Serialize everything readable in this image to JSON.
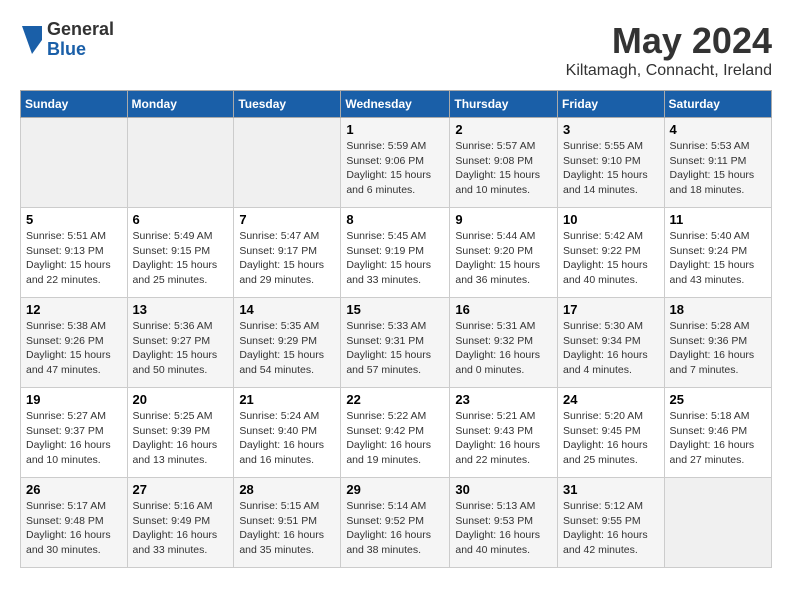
{
  "header": {
    "logo_general": "General",
    "logo_blue": "Blue",
    "month": "May 2024",
    "location": "Kiltamagh, Connacht, Ireland"
  },
  "weekdays": [
    "Sunday",
    "Monday",
    "Tuesday",
    "Wednesday",
    "Thursday",
    "Friday",
    "Saturday"
  ],
  "weeks": [
    [
      {
        "day": "",
        "info": ""
      },
      {
        "day": "",
        "info": ""
      },
      {
        "day": "",
        "info": ""
      },
      {
        "day": "1",
        "info": "Sunrise: 5:59 AM\nSunset: 9:06 PM\nDaylight: 15 hours\nand 6 minutes."
      },
      {
        "day": "2",
        "info": "Sunrise: 5:57 AM\nSunset: 9:08 PM\nDaylight: 15 hours\nand 10 minutes."
      },
      {
        "day": "3",
        "info": "Sunrise: 5:55 AM\nSunset: 9:10 PM\nDaylight: 15 hours\nand 14 minutes."
      },
      {
        "day": "4",
        "info": "Sunrise: 5:53 AM\nSunset: 9:11 PM\nDaylight: 15 hours\nand 18 minutes."
      }
    ],
    [
      {
        "day": "5",
        "info": "Sunrise: 5:51 AM\nSunset: 9:13 PM\nDaylight: 15 hours\nand 22 minutes."
      },
      {
        "day": "6",
        "info": "Sunrise: 5:49 AM\nSunset: 9:15 PM\nDaylight: 15 hours\nand 25 minutes."
      },
      {
        "day": "7",
        "info": "Sunrise: 5:47 AM\nSunset: 9:17 PM\nDaylight: 15 hours\nand 29 minutes."
      },
      {
        "day": "8",
        "info": "Sunrise: 5:45 AM\nSunset: 9:19 PM\nDaylight: 15 hours\nand 33 minutes."
      },
      {
        "day": "9",
        "info": "Sunrise: 5:44 AM\nSunset: 9:20 PM\nDaylight: 15 hours\nand 36 minutes."
      },
      {
        "day": "10",
        "info": "Sunrise: 5:42 AM\nSunset: 9:22 PM\nDaylight: 15 hours\nand 40 minutes."
      },
      {
        "day": "11",
        "info": "Sunrise: 5:40 AM\nSunset: 9:24 PM\nDaylight: 15 hours\nand 43 minutes."
      }
    ],
    [
      {
        "day": "12",
        "info": "Sunrise: 5:38 AM\nSunset: 9:26 PM\nDaylight: 15 hours\nand 47 minutes."
      },
      {
        "day": "13",
        "info": "Sunrise: 5:36 AM\nSunset: 9:27 PM\nDaylight: 15 hours\nand 50 minutes."
      },
      {
        "day": "14",
        "info": "Sunrise: 5:35 AM\nSunset: 9:29 PM\nDaylight: 15 hours\nand 54 minutes."
      },
      {
        "day": "15",
        "info": "Sunrise: 5:33 AM\nSunset: 9:31 PM\nDaylight: 15 hours\nand 57 minutes."
      },
      {
        "day": "16",
        "info": "Sunrise: 5:31 AM\nSunset: 9:32 PM\nDaylight: 16 hours\nand 0 minutes."
      },
      {
        "day": "17",
        "info": "Sunrise: 5:30 AM\nSunset: 9:34 PM\nDaylight: 16 hours\nand 4 minutes."
      },
      {
        "day": "18",
        "info": "Sunrise: 5:28 AM\nSunset: 9:36 PM\nDaylight: 16 hours\nand 7 minutes."
      }
    ],
    [
      {
        "day": "19",
        "info": "Sunrise: 5:27 AM\nSunset: 9:37 PM\nDaylight: 16 hours\nand 10 minutes."
      },
      {
        "day": "20",
        "info": "Sunrise: 5:25 AM\nSunset: 9:39 PM\nDaylight: 16 hours\nand 13 minutes."
      },
      {
        "day": "21",
        "info": "Sunrise: 5:24 AM\nSunset: 9:40 PM\nDaylight: 16 hours\nand 16 minutes."
      },
      {
        "day": "22",
        "info": "Sunrise: 5:22 AM\nSunset: 9:42 PM\nDaylight: 16 hours\nand 19 minutes."
      },
      {
        "day": "23",
        "info": "Sunrise: 5:21 AM\nSunset: 9:43 PM\nDaylight: 16 hours\nand 22 minutes."
      },
      {
        "day": "24",
        "info": "Sunrise: 5:20 AM\nSunset: 9:45 PM\nDaylight: 16 hours\nand 25 minutes."
      },
      {
        "day": "25",
        "info": "Sunrise: 5:18 AM\nSunset: 9:46 PM\nDaylight: 16 hours\nand 27 minutes."
      }
    ],
    [
      {
        "day": "26",
        "info": "Sunrise: 5:17 AM\nSunset: 9:48 PM\nDaylight: 16 hours\nand 30 minutes."
      },
      {
        "day": "27",
        "info": "Sunrise: 5:16 AM\nSunset: 9:49 PM\nDaylight: 16 hours\nand 33 minutes."
      },
      {
        "day": "28",
        "info": "Sunrise: 5:15 AM\nSunset: 9:51 PM\nDaylight: 16 hours\nand 35 minutes."
      },
      {
        "day": "29",
        "info": "Sunrise: 5:14 AM\nSunset: 9:52 PM\nDaylight: 16 hours\nand 38 minutes."
      },
      {
        "day": "30",
        "info": "Sunrise: 5:13 AM\nSunset: 9:53 PM\nDaylight: 16 hours\nand 40 minutes."
      },
      {
        "day": "31",
        "info": "Sunrise: 5:12 AM\nSunset: 9:55 PM\nDaylight: 16 hours\nand 42 minutes."
      },
      {
        "day": "",
        "info": ""
      }
    ]
  ]
}
